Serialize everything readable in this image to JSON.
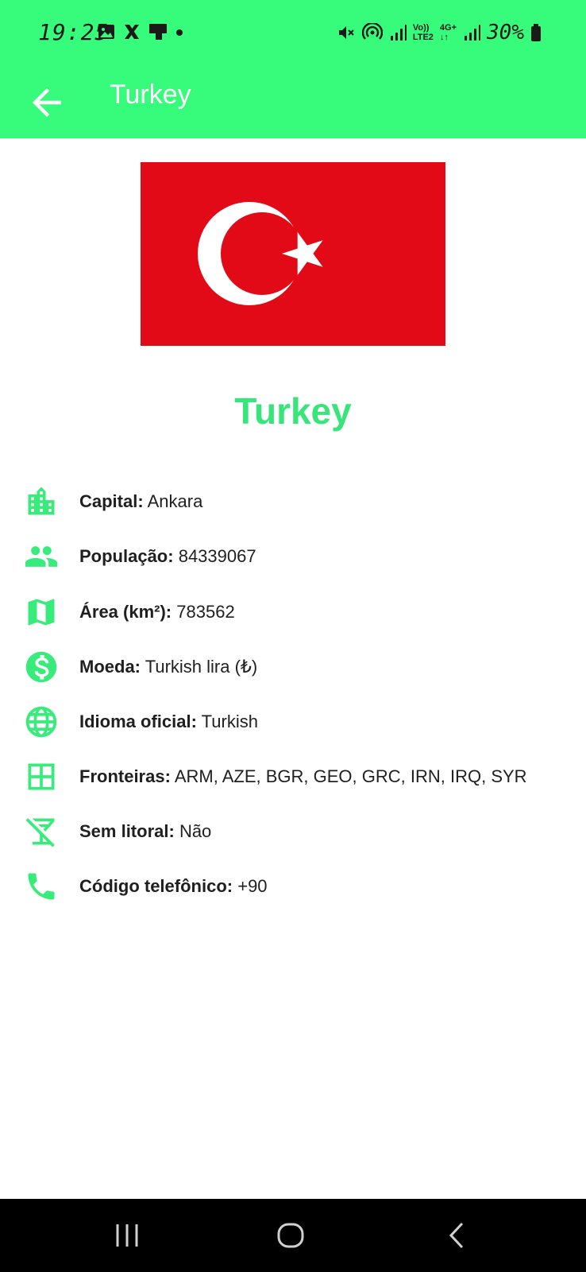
{
  "status_bar": {
    "time": "19:25",
    "network_volte": "Vo))",
    "network_lte": "LTE2",
    "network_4g": "4G+",
    "battery": "30%"
  },
  "app_bar": {
    "title": "Turkey"
  },
  "country": {
    "name": "Turkey",
    "flag_colors": {
      "background": "#e30a17",
      "symbol": "#ffffff"
    }
  },
  "info": {
    "capital": {
      "label": "Capital:",
      "value": "Ankara"
    },
    "population": {
      "label": "População:",
      "value": "84339067"
    },
    "area": {
      "label": "Área (km²):",
      "value": "783562"
    },
    "currency": {
      "label": "Moeda:",
      "value": "Turkish lira (₺)"
    },
    "language": {
      "label": "Idioma oficial:",
      "value": "Turkish"
    },
    "borders": {
      "label": "Fronteiras:",
      "value": "ARM, AZE, BGR, GEO, GRC, IRN, IRQ, SYR"
    },
    "landlocked": {
      "label": "Sem litoral:",
      "value": "Não"
    },
    "phone": {
      "label": "Código telefônico:",
      "value": "+90"
    }
  },
  "colors": {
    "accent": "#37fb7a",
    "accent_text": "#37e57a",
    "icon": "#37ec7a"
  },
  "icons": {
    "capital": "city-icon",
    "population": "people-icon",
    "area": "map-icon",
    "currency": "dollar-icon",
    "language": "globe-icon",
    "borders": "grid-icon",
    "landlocked": "no-drinks-icon",
    "phone": "phone-icon"
  }
}
